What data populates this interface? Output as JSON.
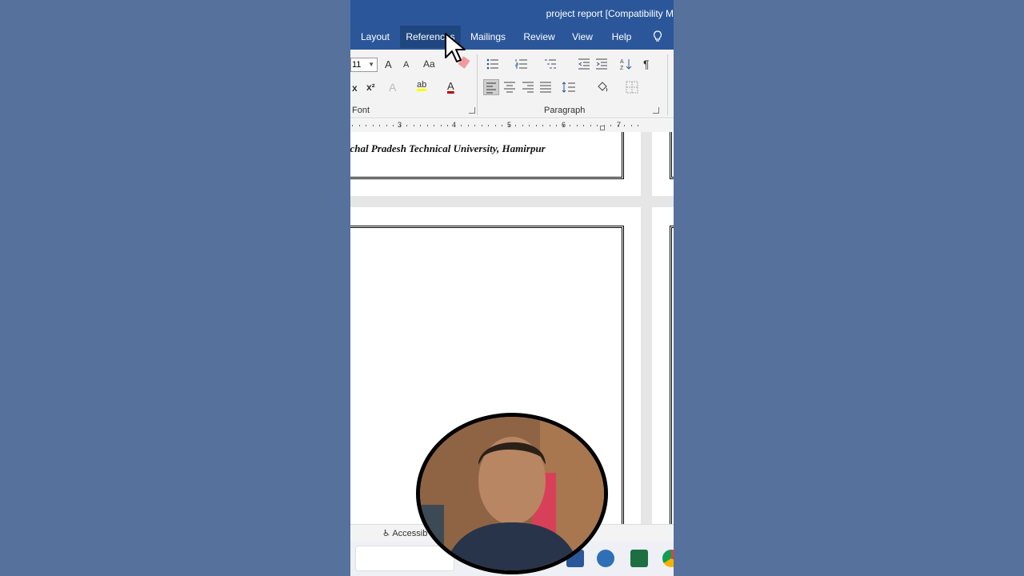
{
  "window": {
    "title": "project report [Compatibility M"
  },
  "tabs": [
    {
      "label": "Layout"
    },
    {
      "label": "References"
    },
    {
      "label": "Mailings"
    },
    {
      "label": "Review"
    },
    {
      "label": "View"
    },
    {
      "label": "Help"
    }
  ],
  "active_tab": "References",
  "ribbon": {
    "font_size": "11",
    "font_group_label": "Font",
    "paragraph_group_label": "Paragraph",
    "buttons": {
      "grow_font": "A",
      "shrink_font": "A",
      "change_case": "Aa",
      "subscript": "x",
      "superscript": "x²",
      "text_effects": "A",
      "highlight": "ab",
      "font_color": "A",
      "show_marks": "¶"
    }
  },
  "ruler": {
    "numbers": [
      "3",
      "4",
      "5",
      "6",
      "7"
    ]
  },
  "document": {
    "page1_text": "achal Pradesh Technical University, Hamirpur"
  },
  "statusbar": {
    "accessibility": "Accessib"
  },
  "colors": {
    "title_bar": "#2b579a",
    "background": "#56719c",
    "highlight": "#ffff00",
    "font_color": "#c00000"
  },
  "icons": [
    "lightbulb-icon",
    "word-app-icon",
    "photos-app-icon",
    "excel-app-icon",
    "chrome-app-icon",
    "mouse-cursor-icon"
  ]
}
